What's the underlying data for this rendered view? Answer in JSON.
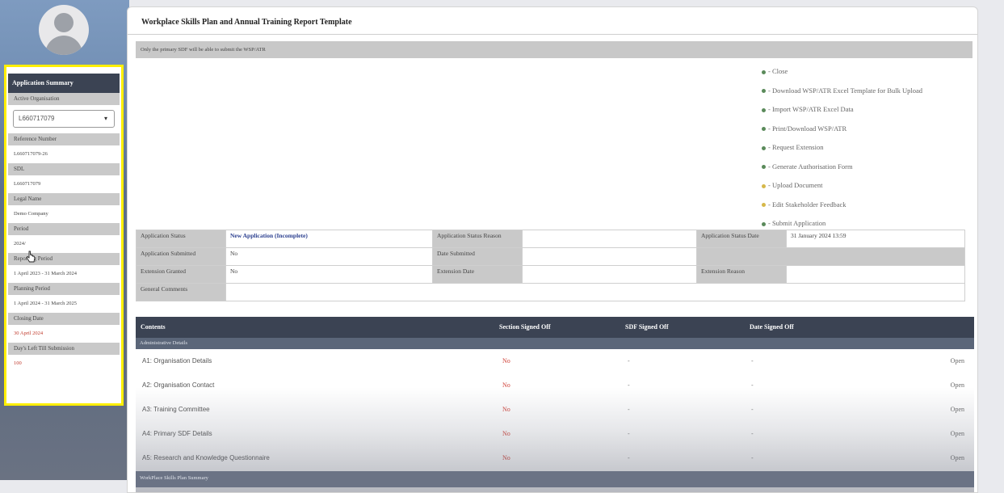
{
  "sidebar": {
    "summary_title": "Application Summary",
    "active_org_label": "Active Organisation",
    "active_org_value": "L660717079",
    "fields": [
      {
        "label": "Reference Number",
        "value": "L660717079-26",
        "red": false
      },
      {
        "label": "SDL",
        "value": "L660717079",
        "red": false
      },
      {
        "label": "Legal Name",
        "value": "Demo Company",
        "red": false
      },
      {
        "label": "Period",
        "value": "2024/",
        "red": false
      },
      {
        "label": "Reporting Period",
        "value": "1 April 2023 - 31 March 2024",
        "red": false
      },
      {
        "label": "Planning Period",
        "value": "1 April 2024 - 31 March 2025",
        "red": false
      },
      {
        "label": "Closing Date",
        "value": "30 April 2024",
        "red": true
      },
      {
        "label": "Day's Left Till Submission",
        "value": "100",
        "red": true
      }
    ]
  },
  "header": {
    "title": "Workplace Skills Plan and Annual Training Report Template",
    "notice": "Only the primary SDF will be able to submit the WSP/ATR"
  },
  "actions": [
    {
      "label": "- Close",
      "color": "green"
    },
    {
      "label": "- Download WSP/ATR Excel Template for Bulk Upload",
      "color": "green"
    },
    {
      "label": "- Import WSP/ATR Excel Data",
      "color": "green"
    },
    {
      "label": "- Print/Download WSP/ATR",
      "color": "green"
    },
    {
      "label": "- Request Extension",
      "color": "green"
    },
    {
      "label": "- Generate Authorisation Form",
      "color": "green"
    },
    {
      "label": "- Upload Document",
      "color": "yellow"
    },
    {
      "label": "- Edit Stakeholder Feedback",
      "color": "yellow"
    },
    {
      "label": "- Submit Application",
      "color": "green"
    }
  ],
  "status": {
    "app_status_label": "Application Status",
    "app_status_value": "New Application (Incomplete)",
    "app_status_reason_label": "Application Status Reason",
    "app_status_date_label": "Application Status Date",
    "app_status_date_value": "31 January 2024 13:59",
    "submitted_label": "Application Submitted",
    "submitted_value": "No",
    "date_submitted_label": "Date Submitted",
    "ext_granted_label": "Extension Granted",
    "ext_granted_value": "No",
    "ext_date_label": "Extension Date",
    "ext_reason_label": "Extension Reason",
    "comments_label": "General Comments"
  },
  "content": {
    "headers": [
      "Contents",
      "Section Signed Off",
      "SDF Signed Off",
      "Date Signed Off"
    ],
    "section1": "Administrative Details",
    "rows": [
      {
        "name": "A1: Organisation Details",
        "section": "No",
        "sdf": "-",
        "date": "-",
        "action": "Open"
      },
      {
        "name": "A2: Organisation Contact",
        "section": "No",
        "sdf": "-",
        "date": "-",
        "action": "Open"
      },
      {
        "name": "A3: Training Committee",
        "section": "No",
        "sdf": "-",
        "date": "-",
        "action": "Open"
      },
      {
        "name": "A4: Primary SDF Details",
        "section": "No",
        "sdf": "-",
        "date": "-",
        "action": "Open"
      },
      {
        "name": "A5: Research and Knowledge Questionnaire",
        "section": "No",
        "sdf": "-",
        "date": "-",
        "action": "Open"
      }
    ],
    "section2": "WorkPlace Skills Plan Summary"
  }
}
